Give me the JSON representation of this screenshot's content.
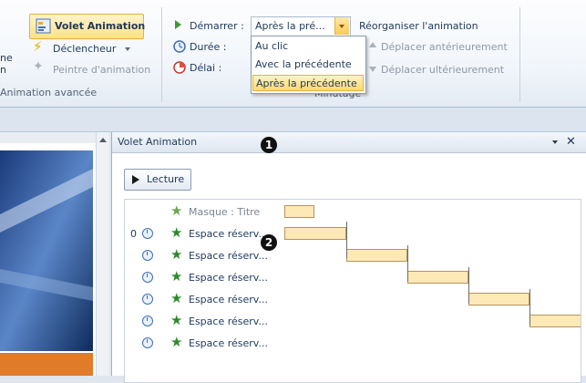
{
  "ribbon": {
    "group_advanced": {
      "volet_label": "Volet Animation",
      "declencheur_label": "Déclencheur",
      "peintre_label": "Peintre d'animation",
      "partial_top": "ne",
      "partial_bottom": "n",
      "group_title": "Animation avancée"
    },
    "group_timing": {
      "demarrer_label": "Démarrer :",
      "demarrer_value": "Après la pré...",
      "duree_label": "Durée :",
      "delai_label": "Délai :",
      "reorder_title": "Réorganiser l'animation",
      "move_earlier": "Déplacer antérieurement",
      "move_later": "Déplacer ultérieurement",
      "group_title": "Minutage"
    },
    "start_dropdown": {
      "options": [
        "Au clic",
        "Avec la précédente",
        "Après la précédente"
      ],
      "selected_index": 2
    }
  },
  "pane": {
    "title": "Volet Animation",
    "play_label": "Lecture",
    "items": [
      {
        "num": "",
        "label": "Masque : Titre",
        "clock": false
      },
      {
        "num": "0",
        "label": "Espace réserv...",
        "clock": true
      },
      {
        "num": "",
        "label": "Espace réserv...",
        "clock": true
      },
      {
        "num": "",
        "label": "Espace réserv...",
        "clock": true
      },
      {
        "num": "",
        "label": "Espace réserv...",
        "clock": true
      },
      {
        "num": "",
        "label": "Espace réserv...",
        "clock": true
      },
      {
        "num": "",
        "label": "Espace réserv...",
        "clock": true
      }
    ]
  },
  "callouts": {
    "one": "1",
    "two": "2"
  },
  "colors": {
    "accent": "#ffd96b",
    "bar_fill": "#fde9b6",
    "star": "#2f8a2b"
  }
}
